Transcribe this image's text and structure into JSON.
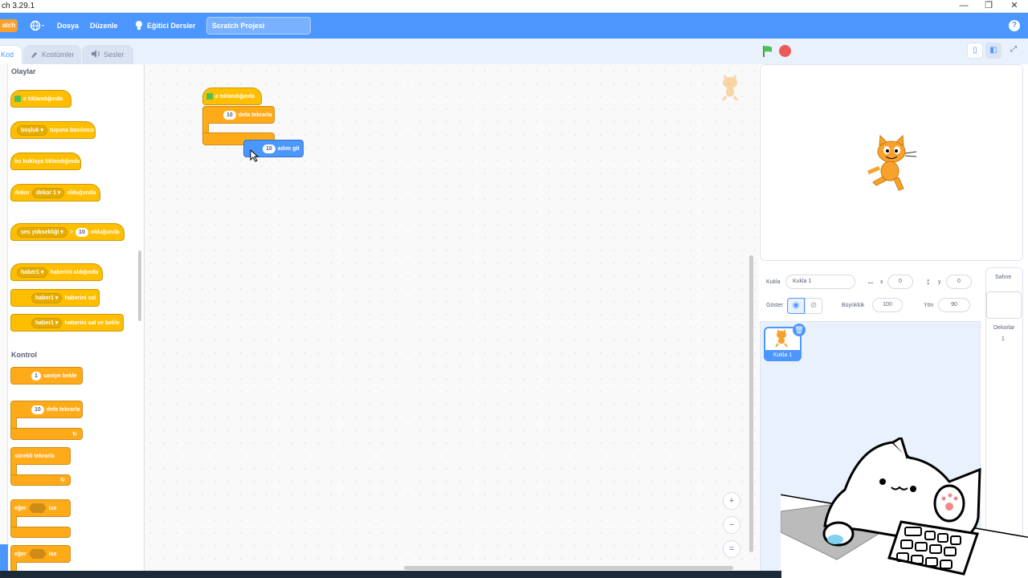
{
  "window": {
    "title": "ch 3.29.1",
    "controls": [
      "—",
      "❐",
      "✕"
    ]
  },
  "menubar": {
    "logo_text": "atch",
    "file_label": "Dosya",
    "edit_label": "Düzenle",
    "tutorials_label": "Eğitici Dersler",
    "project_title": "Scratch Projesi",
    "help_glyph": "?"
  },
  "tabs": {
    "code": "Kod",
    "costumes": "Kostümler",
    "sounds": "Sesler"
  },
  "palette": {
    "events_heading": "Olaylar",
    "control_heading": "Kontrol",
    "events": {
      "flag_clicked": "e tıklandığında",
      "key_pressed_key": "boşluk",
      "key_pressed_text": "tuşuna basılınca",
      "sprite_clicked": "bu kuklaya tıklandığında",
      "backdrop_switch_label": "dekor",
      "backdrop_switch_value": "dekor 1",
      "backdrop_switch_text": "olduğunda",
      "greater_than_menu": "ses yüksekliği",
      "greater_than_op": ">",
      "greater_than_value": "10",
      "greater_than_text": "olduğunda",
      "receive_msg": "haber1",
      "receive_text": "haberini aldığında",
      "broadcast_msg": "haber1",
      "broadcast_text": "haberini sal",
      "broadcast_wait_msg": "haber1",
      "broadcast_wait_text": "haberini sal ve bekle"
    },
    "control": {
      "wait_value": "1",
      "wait_text": "saniye bekle",
      "repeat_value": "10",
      "repeat_text": "defa tekrarla",
      "forever_text": "sürekli tekrarla",
      "if_label": "eğer",
      "if_then": "ise",
      "ifelse_label": "eğer",
      "ifelse_then": "ise"
    }
  },
  "workspace": {
    "script": {
      "hat_text": "e tıklandığında",
      "repeat_value": "10",
      "repeat_text": "defa tekrarla",
      "dragged_move_value": "10",
      "dragged_move_text": "adım git"
    },
    "zoom_in": "+",
    "zoom_out": "−",
    "zoom_reset": "="
  },
  "sprite_info": {
    "sprite_label": "Kukla",
    "sprite_name": "Kukla 1",
    "x_label": "x",
    "x_value": "0",
    "y_label": "y",
    "y_value": "0",
    "show_label": "Göster",
    "size_label": "Büyüklük",
    "size_value": "100",
    "direction_label": "Yön",
    "direction_value": "90"
  },
  "sprite_list": [
    {
      "name": "Kukla 1",
      "selected": true
    }
  ],
  "stage_pane": {
    "title": "Sahne",
    "backdrops_label": "Dekorlar",
    "backdrops_count": "1"
  },
  "colors": {
    "accent": "#4c97ff",
    "events": "#ffbf00",
    "control": "#ffab19",
    "motion": "#4c97ff"
  }
}
